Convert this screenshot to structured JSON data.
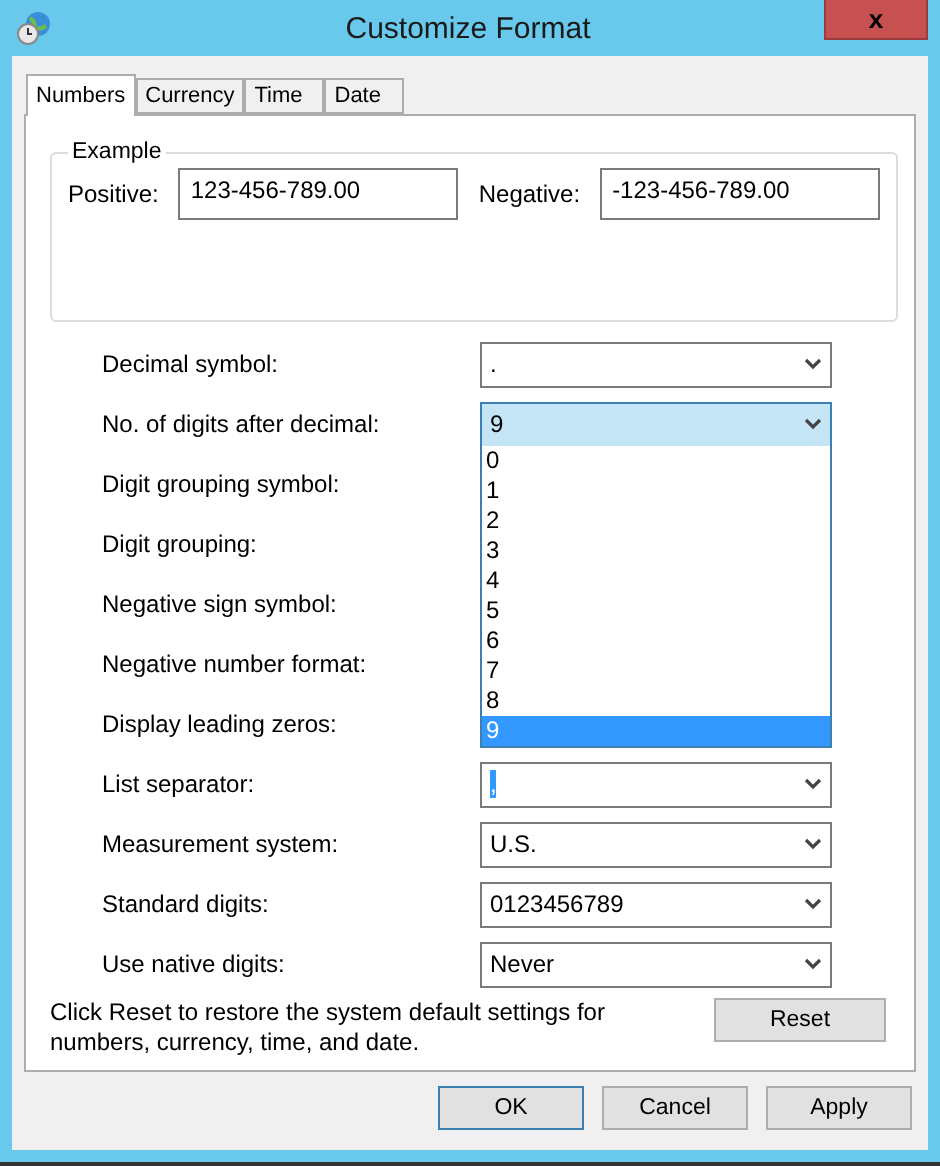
{
  "window": {
    "title": "Customize Format",
    "close": "x"
  },
  "tabs": [
    {
      "label": "Numbers",
      "selected": true
    },
    {
      "label": "Currency",
      "selected": false
    },
    {
      "label": "Time",
      "selected": false
    },
    {
      "label": "Date",
      "selected": false
    }
  ],
  "example": {
    "title": "Example",
    "positive_label": "Positive:",
    "positive_value": "123-456-789.00",
    "negative_label": "Negative:",
    "negative_value": "-123-456-789.00"
  },
  "settings": [
    {
      "label": "Decimal symbol:",
      "value": ".",
      "open": false,
      "text_selected": false
    },
    {
      "label": "No. of digits after decimal:",
      "value": "9",
      "open": true,
      "text_selected": false,
      "options": [
        {
          "label": "0",
          "selected": false
        },
        {
          "label": "1",
          "selected": false
        },
        {
          "label": "2",
          "selected": false
        },
        {
          "label": "3",
          "selected": false
        },
        {
          "label": "4",
          "selected": false
        },
        {
          "label": "5",
          "selected": false
        },
        {
          "label": "6",
          "selected": false
        },
        {
          "label": "7",
          "selected": false
        },
        {
          "label": "8",
          "selected": false
        },
        {
          "label": "9",
          "selected": true
        }
      ]
    },
    {
      "label": "Digit grouping symbol:"
    },
    {
      "label": "Digit grouping:"
    },
    {
      "label": "Negative sign symbol:"
    },
    {
      "label": "Negative number format:"
    },
    {
      "label": "Display leading zeros:"
    },
    {
      "label": "List separator:",
      "value": ",",
      "open": false,
      "text_selected": true
    },
    {
      "label": "Measurement system:",
      "value": "U.S.",
      "open": false,
      "text_selected": false
    },
    {
      "label": "Standard digits:",
      "value": "0123456789",
      "open": false,
      "text_selected": false
    },
    {
      "label": "Use native digits:",
      "value": "Never",
      "open": false,
      "text_selected": false
    }
  ],
  "reset_note": "Click Reset to restore the system default settings for numbers, currency, time, and date.",
  "reset_button": "Reset",
  "buttons": [
    {
      "label": "OK",
      "default": true
    },
    {
      "label": "Cancel",
      "default": false
    },
    {
      "label": "Apply",
      "default": false
    }
  ]
}
